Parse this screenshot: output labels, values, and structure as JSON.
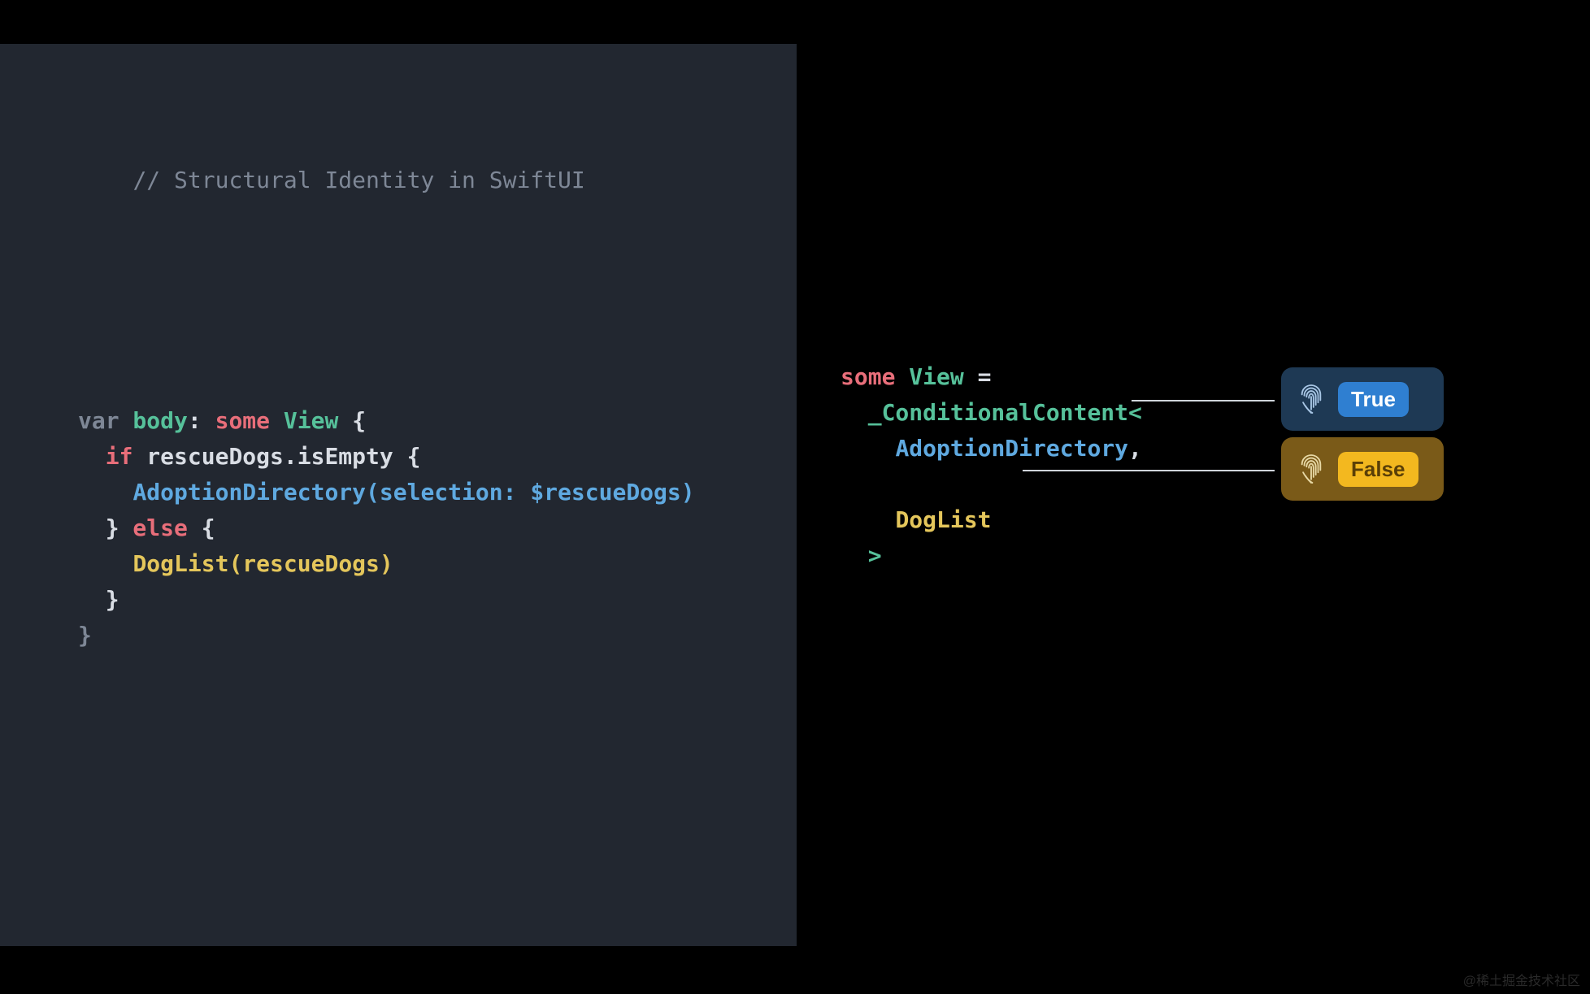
{
  "title_comment": "// Structural Identity in SwiftUI",
  "left": {
    "var_kw": "var",
    "body_name": " body",
    "colon": ": ",
    "some_kw": "some",
    "view_type": " View ",
    "open_brace": "{",
    "if_kw": "if",
    "cond": " rescueDogs.isEmpty ",
    "open_brace2": "{",
    "adoption_call": "AdoptionDirectory",
    "adoption_args_open": "(",
    "adoption_label": "selection",
    "adoption_colon": ": ",
    "adoption_arg": "$rescueDogs",
    "adoption_args_close": ")",
    "close_brace_if": "}",
    "else_kw": " else ",
    "open_brace3": "{",
    "doglist_call": "DogList",
    "doglist_args": "(rescueDogs)",
    "close_brace_else": "}",
    "close_brace_body": "}"
  },
  "right": {
    "some_kw": "some",
    "view_type": " View ",
    "equals": "=",
    "conditional": "_ConditionalContent",
    "lt": "<",
    "adoption": "AdoptionDirectory",
    "comma": ",",
    "doglist": "DogList",
    "gt": ">"
  },
  "badges": {
    "true_label": "True",
    "false_label": "False"
  },
  "watermark": "@稀土掘金技术社区"
}
